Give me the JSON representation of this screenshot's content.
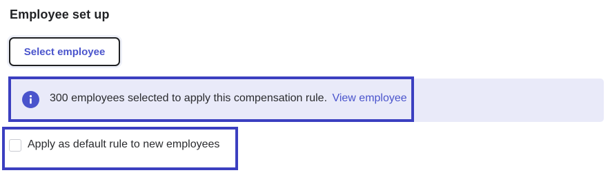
{
  "section": {
    "title": "Employee set up"
  },
  "actions": {
    "select_employee_label": "Select employee"
  },
  "info_banner": {
    "icon": "info-icon",
    "message": "300 employees selected to apply this compensation rule.",
    "link_label": "View employee",
    "background_color": "#e9eaf9",
    "accent_color": "#4a54cc"
  },
  "default_rule": {
    "checked": false,
    "label": "Apply as default rule to new employees"
  },
  "highlight_color": "#3b3fc0"
}
